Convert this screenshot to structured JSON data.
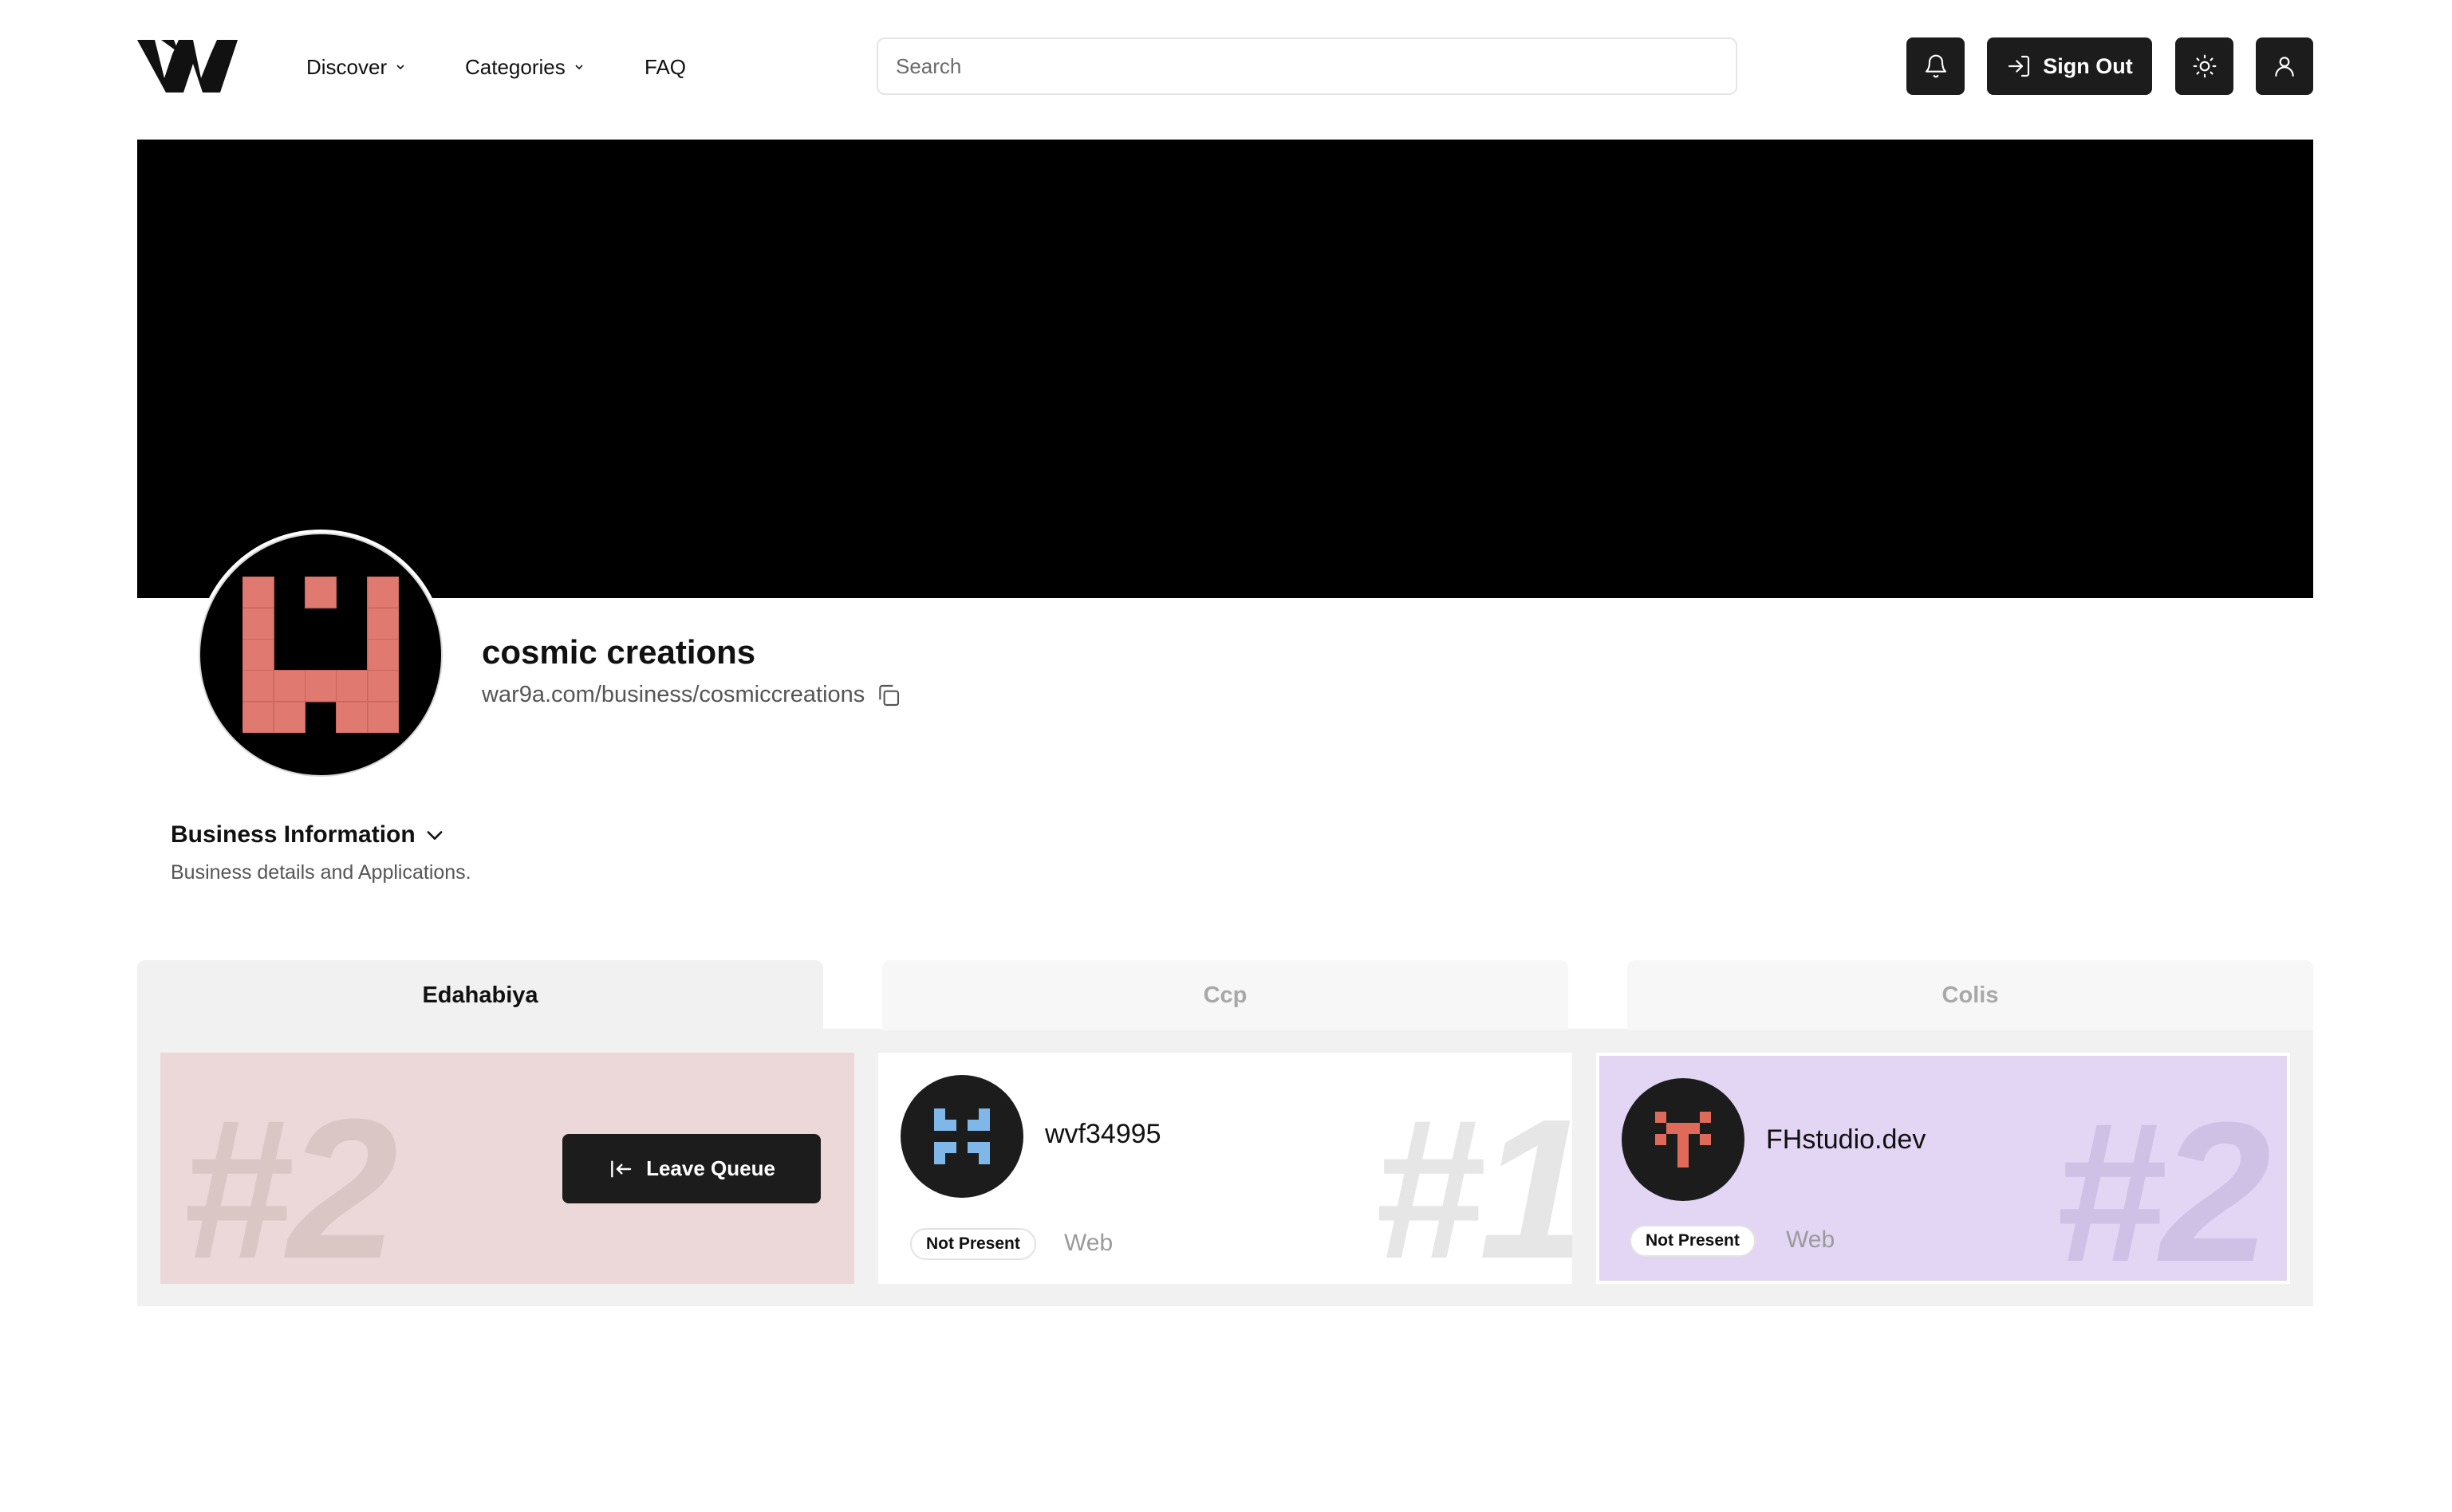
{
  "header": {
    "logo_icon": "w-logo-icon",
    "nav": [
      {
        "label": "Discover",
        "has_dropdown": true
      },
      {
        "label": "Categories",
        "has_dropdown": true
      },
      {
        "label": "FAQ",
        "has_dropdown": false
      }
    ],
    "search": {
      "placeholder": "Search",
      "value": ""
    },
    "buttons": {
      "notifications_icon": "bell-icon",
      "sign_out_label": "Sign Out",
      "sign_out_icon": "sign-in-arrow-icon",
      "theme_icon": "sun-icon",
      "profile_icon": "user-icon"
    }
  },
  "profile": {
    "name": "cosmic creations",
    "url": "war9a.com/business/cosmiccreations",
    "copy_icon": "copy-icon",
    "avatar_color": "#e07a70"
  },
  "business_info": {
    "title": "Business Information",
    "description": "Business details and Applications."
  },
  "tabs": [
    {
      "label": "Edahabiya",
      "active": true
    },
    {
      "label": "Ccp",
      "active": false
    },
    {
      "label": "Colis",
      "active": false
    }
  ],
  "queue": {
    "own_position": "#2",
    "leave_label": "Leave Queue",
    "entries": [
      {
        "name": "wvf34995",
        "rank": "#1",
        "status": "Not Present",
        "type": "Web",
        "avatar_color": "#7fb8e8",
        "background": "#ffffff"
      },
      {
        "name": "FHstudio.dev",
        "rank": "#2",
        "status": "Not Present",
        "type": "Web",
        "avatar_color": "#e06a5a",
        "background": "#e2d6f4"
      }
    ]
  },
  "colors": {
    "primary_button": "#1c1c1c",
    "own_card_bg": "#ecd8d8",
    "tab_panel_bg": "#f1f1f1"
  }
}
